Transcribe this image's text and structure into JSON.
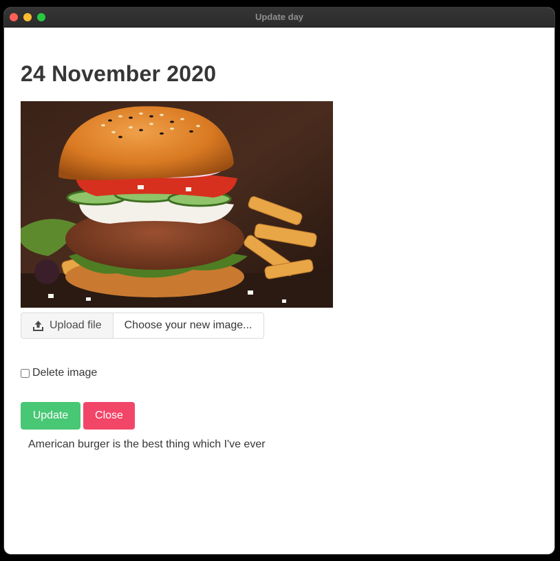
{
  "window": {
    "title": "Update day"
  },
  "day": {
    "date": "24 November 2020",
    "note": "American burger is the best thing which I've ever"
  },
  "upload": {
    "button_label": "Upload file",
    "file_placeholder": "Choose your new image...",
    "icon": "upload-icon"
  },
  "delete_image": {
    "label": "Delete image",
    "checked": false
  },
  "actions": {
    "update_label": "Update",
    "close_label": "Close"
  },
  "colors": {
    "update": "#48c774",
    "close": "#f14668",
    "text": "#363636"
  }
}
